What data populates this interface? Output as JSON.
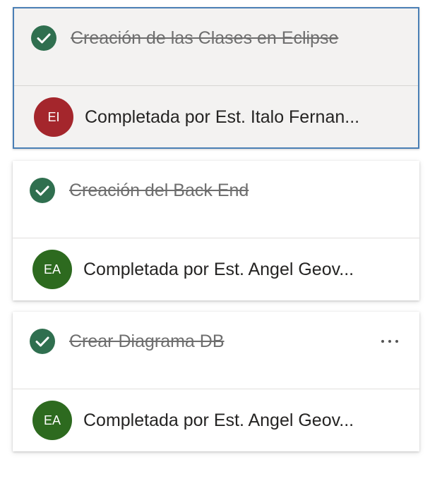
{
  "colors": {
    "check_green": "#2f6f4f",
    "selected_border": "#4a7fb5",
    "selected_background": "#f3f2f1"
  },
  "tasks": [
    {
      "title": "Creación de las Clases en Eclipse",
      "completed_by": "Completada por Est. Italo Fernan...",
      "initials": "EI",
      "avatar_color": "#a4262c",
      "selected": true,
      "icon": "check-circle-icon"
    },
    {
      "title": "Creación del Back End",
      "completed_by": "Completada por Est. Angel Geov...",
      "initials": "EA",
      "avatar_color": "#2d6a1f",
      "selected": false,
      "icon": "check-circle-icon"
    },
    {
      "title": "Crear Diagrama DB",
      "completed_by": "Completada por Est. Angel Geov...",
      "initials": "EA",
      "avatar_color": "#2d6a1f",
      "selected": false,
      "icon": "check-circle-icon",
      "more_icon": "more-options-icon"
    }
  ]
}
